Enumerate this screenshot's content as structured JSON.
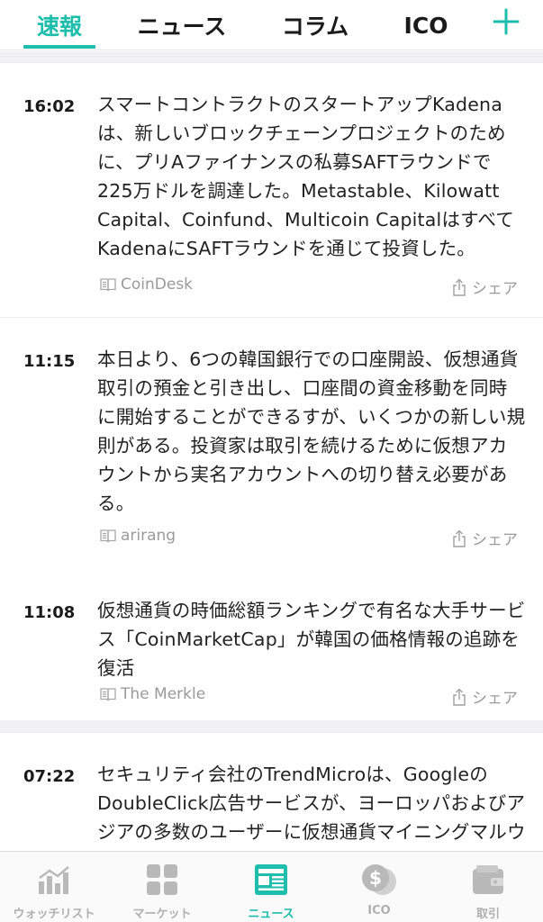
{
  "colors": {
    "accent": "#1ebeac",
    "muted": "#9a9a9a",
    "separator": "#f1f1f3",
    "inactive_icon": "#b9b9b9"
  },
  "top_tabs": [
    {
      "label": "速報",
      "active": true
    },
    {
      "label": "ニュース",
      "active": false
    },
    {
      "label": "コラム",
      "active": false
    },
    {
      "label": "ICO",
      "active": false
    }
  ],
  "add_icon": "plus-icon",
  "news": [
    {
      "time": "16:02",
      "body": "スマートコントラクトのスタートアップKadenaは、新しいブロックチェーンプロジェクトのために、プリAファイナンスの私募SAFTラウンドで225万ドルを調達した。Metastable、Kilowatt Capital、Coinfund、Multicoin CapitalはすべてKadenaにSAFTラウンドを通じて投資した。",
      "source": "CoinDesk",
      "share": "シェア"
    },
    {
      "time": "11:15",
      "body": "本日より、6つの韓国銀行での口座開設、仮想通貨取引の預金と引き出し、口座間の資金移動を同時に開始することができるすが、いくつかの新しい規則がある。投資家は取引を続けるために仮想アカウントから実名アカウントへの切り替え必要がある。",
      "source": "arirang",
      "share": "シェア"
    },
    {
      "time": "11:08",
      "body": "仮想通貨の時価総額ランキングで有名な大手サービス「CoinMarketCap」が韓国の価格情報の追跡を復活",
      "source": "The Merkle",
      "share": "シェア"
    },
    {
      "time": "07:22",
      "body": "セキュリティ会社のTrendMicroは、GoogleのDoubleClick広告サービスが、ヨーロッパおよびアジアの多数のユーザーに仮想通貨マイニングマルウェアを配布するために利用されたという新し",
      "source": "",
      "share": ""
    }
  ],
  "bottom_nav": [
    {
      "label": "ウォッチリスト",
      "icon": "bar-chart-icon",
      "active": false
    },
    {
      "label": "マーケット",
      "icon": "grid-icon",
      "active": false
    },
    {
      "label": "ニュース",
      "icon": "newspaper-icon",
      "active": true
    },
    {
      "label": "ICO",
      "icon": "coins-icon",
      "active": false
    },
    {
      "label": "取引",
      "icon": "wallet-icon",
      "active": false
    }
  ]
}
